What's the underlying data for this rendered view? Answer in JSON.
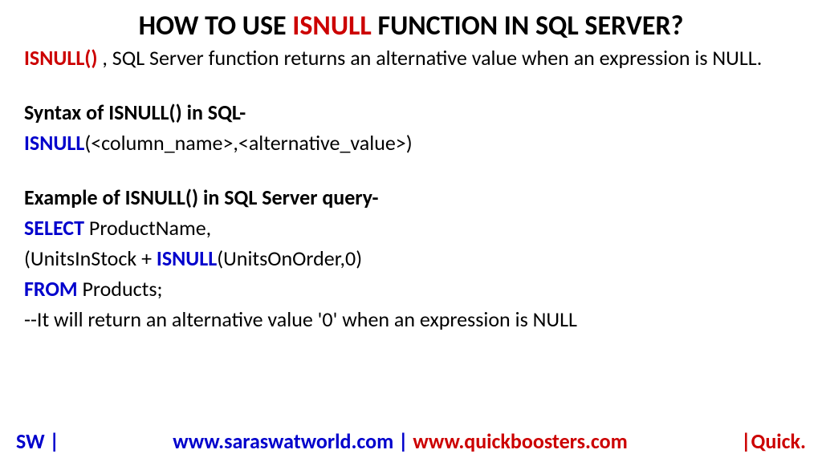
{
  "title": {
    "prefix": "HOW TO USE ",
    "highlight": "ISNULL",
    "suffix": " FUNCTION IN SQL SERVER?"
  },
  "intro": {
    "keyword": "ISNULL()",
    "text": " , SQL Server function returns an alternative value when an expression is NULL."
  },
  "syntax": {
    "heading": "Syntax of ISNULL() in SQL-",
    "keyword": "ISNULL",
    "rest": "(<column_name>,<alternative_value>)"
  },
  "example": {
    "heading": "Example of ISNULL() in SQL Server query-",
    "line1": {
      "keyword": "SELECT",
      "rest": " ProductName,"
    },
    "line2": {
      "prefix": "(UnitsInStock + ",
      "keyword": "ISNULL",
      "rest": "(UnitsOnOrder,0)"
    },
    "line3": {
      "keyword": "FROM",
      "rest": " Products;"
    },
    "line4": "--It will return an alternative value '0' when an expression is NULL"
  },
  "footer": {
    "left": "SW |",
    "url1": "www.saraswatworld.com",
    "separator": " | ",
    "url2": "www.quickboosters.com",
    "right": "|Quick."
  }
}
